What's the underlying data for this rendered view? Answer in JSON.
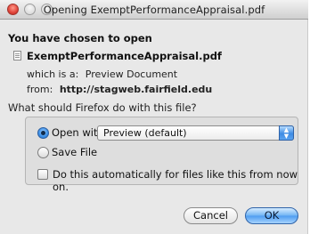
{
  "window": {
    "title": "Opening ExemptPerformanceAppraisal.pdf"
  },
  "dialog": {
    "heading": "You have chosen to open",
    "file_icon": "document-icon",
    "filename": "ExemptPerformanceAppraisal.pdf",
    "which_is_label": "which is a:",
    "which_is_value": "Preview Document",
    "from_label": "from:",
    "from_value": "http://stagweb.fairfield.edu",
    "question": "What should Firefox do with this file?"
  },
  "options": {
    "open_with_label": "Open with",
    "open_with_selected": true,
    "app_select_value": "Preview (default)",
    "save_file_label": "Save File",
    "save_file_selected": false,
    "auto_checkbox_label": "Do this automatically for files like this from now on.",
    "auto_checked": false
  },
  "buttons": {
    "cancel": "Cancel",
    "ok": "OK"
  },
  "colors": {
    "accent": "#3d8be3",
    "window_bg": "#e8e8e8",
    "close_light": "#e0443a"
  }
}
